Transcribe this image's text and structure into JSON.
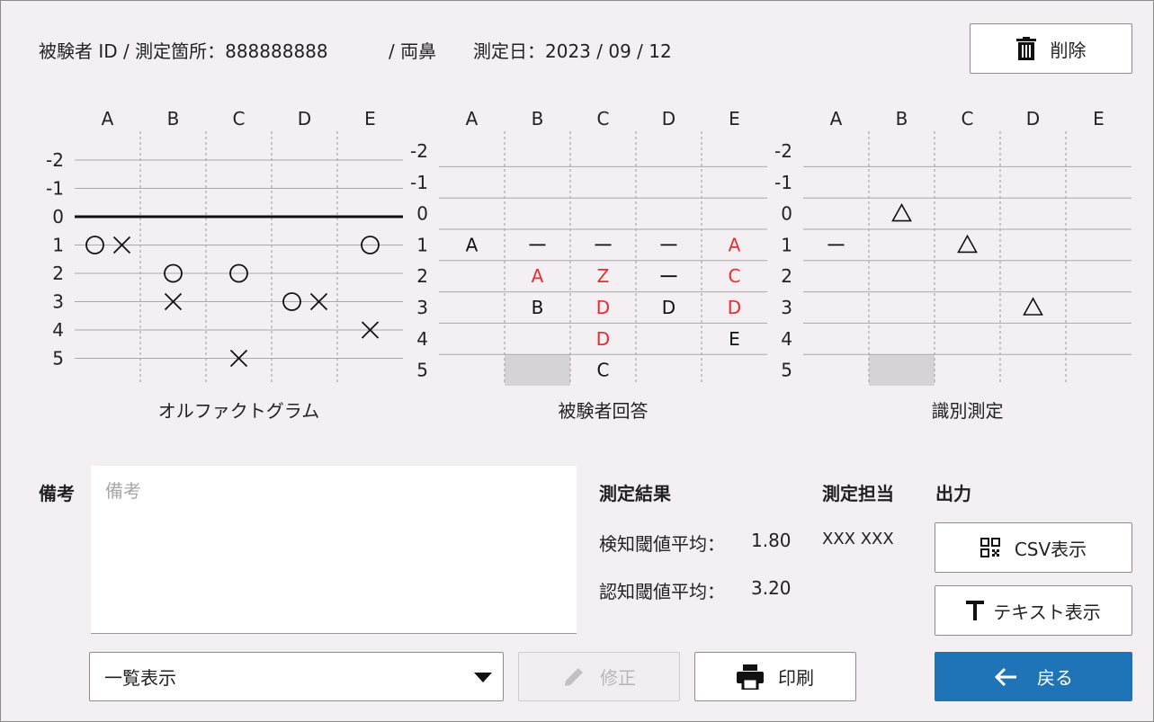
{
  "header": {
    "subject_label": "被験者 ID / 測定箇所：888888888",
    "site": "/ 両鼻",
    "date_label": "測定日：2023 / 09 / 12",
    "delete_label": "削除"
  },
  "charts": {
    "columns": [
      "A",
      "B",
      "C",
      "D",
      "E"
    ],
    "rows": [
      "-2",
      "-1",
      "0",
      "1",
      "2",
      "3",
      "4",
      "5"
    ],
    "olfactogram_title": "オルファクトグラム",
    "answers_title": "被験者回答",
    "identification_title": "識別測定",
    "symbols": {
      "circle": "○",
      "cross": "×",
      "triangle": "△",
      "dash": "—"
    },
    "answer_color_wrong": "#e03030"
  },
  "chart_data": [
    {
      "type": "scatter",
      "title": "オルファクトグラム",
      "x": [
        "A",
        "B",
        "C",
        "D",
        "E"
      ],
      "y_ticks": [
        -2,
        -1,
        0,
        1,
        2,
        3,
        4,
        5
      ],
      "detection_circle": {
        "A": 1,
        "B": 2,
        "C": 2,
        "D": 3,
        "E": 1
      },
      "recognition_cross": {
        "A": 1,
        "B": 3,
        "C": 5,
        "D": 3,
        "E": 4
      }
    },
    {
      "type": "table",
      "title": "被験者回答",
      "cells": [
        {
          "col": "A",
          "row": 1,
          "text": "A",
          "wrong": false
        },
        {
          "col": "B",
          "row": 1,
          "text": "—",
          "wrong": false
        },
        {
          "col": "C",
          "row": 1,
          "text": "—",
          "wrong": false
        },
        {
          "col": "D",
          "row": 1,
          "text": "—",
          "wrong": false
        },
        {
          "col": "E",
          "row": 1,
          "text": "A",
          "wrong": true
        },
        {
          "col": "B",
          "row": 2,
          "text": "A",
          "wrong": true
        },
        {
          "col": "C",
          "row": 2,
          "text": "Z",
          "wrong": true
        },
        {
          "col": "D",
          "row": 2,
          "text": "—",
          "wrong": false
        },
        {
          "col": "E",
          "row": 2,
          "text": "C",
          "wrong": true
        },
        {
          "col": "B",
          "row": 3,
          "text": "B",
          "wrong": false
        },
        {
          "col": "C",
          "row": 3,
          "text": "D",
          "wrong": true
        },
        {
          "col": "D",
          "row": 3,
          "text": "D",
          "wrong": false
        },
        {
          "col": "E",
          "row": 3,
          "text": "D",
          "wrong": true
        },
        {
          "col": "C",
          "row": 4,
          "text": "D",
          "wrong": true
        },
        {
          "col": "E",
          "row": 4,
          "text": "E",
          "wrong": false
        },
        {
          "col": "C",
          "row": 5,
          "text": "C",
          "wrong": false
        }
      ],
      "shaded": [
        {
          "col": "B",
          "row": 5
        }
      ]
    },
    {
      "type": "table",
      "title": "識別測定",
      "cells": [
        {
          "col": "B",
          "row": 0,
          "text": "△"
        },
        {
          "col": "A",
          "row": 1,
          "text": "—"
        },
        {
          "col": "C",
          "row": 1,
          "text": "△"
        },
        {
          "col": "D",
          "row": 3,
          "text": "△"
        }
      ],
      "shaded": [
        {
          "col": "B",
          "row": 5
        }
      ]
    }
  ],
  "memo": {
    "label": "備考",
    "placeholder": "備考",
    "value": ""
  },
  "results": {
    "title": "測定結果",
    "detection_label": "検知閾値平均：",
    "detection_value": "1.80",
    "recognition_label": "認知閾値平均：",
    "recognition_value": "3.20"
  },
  "staff": {
    "title": "測定担当",
    "name": "XXX XXX"
  },
  "output": {
    "title": "出力",
    "csv_label": "CSV表示",
    "text_label": "テキスト表示"
  },
  "footer": {
    "view_select": "一覧表示",
    "edit_label": "修正",
    "print_label": "印刷",
    "back_label": "戻る"
  },
  "colors": {
    "primary": "#1f73b7",
    "wrong_answer": "#e03030",
    "shade": "#d6d3d7"
  },
  "icons": {
    "delete": "trash-icon",
    "edit": "pencil-icon",
    "print": "printer-icon",
    "back": "arrow-left-icon",
    "csv": "qr-icon",
    "text": "text-t-icon",
    "dropdown": "caret-down-icon"
  }
}
